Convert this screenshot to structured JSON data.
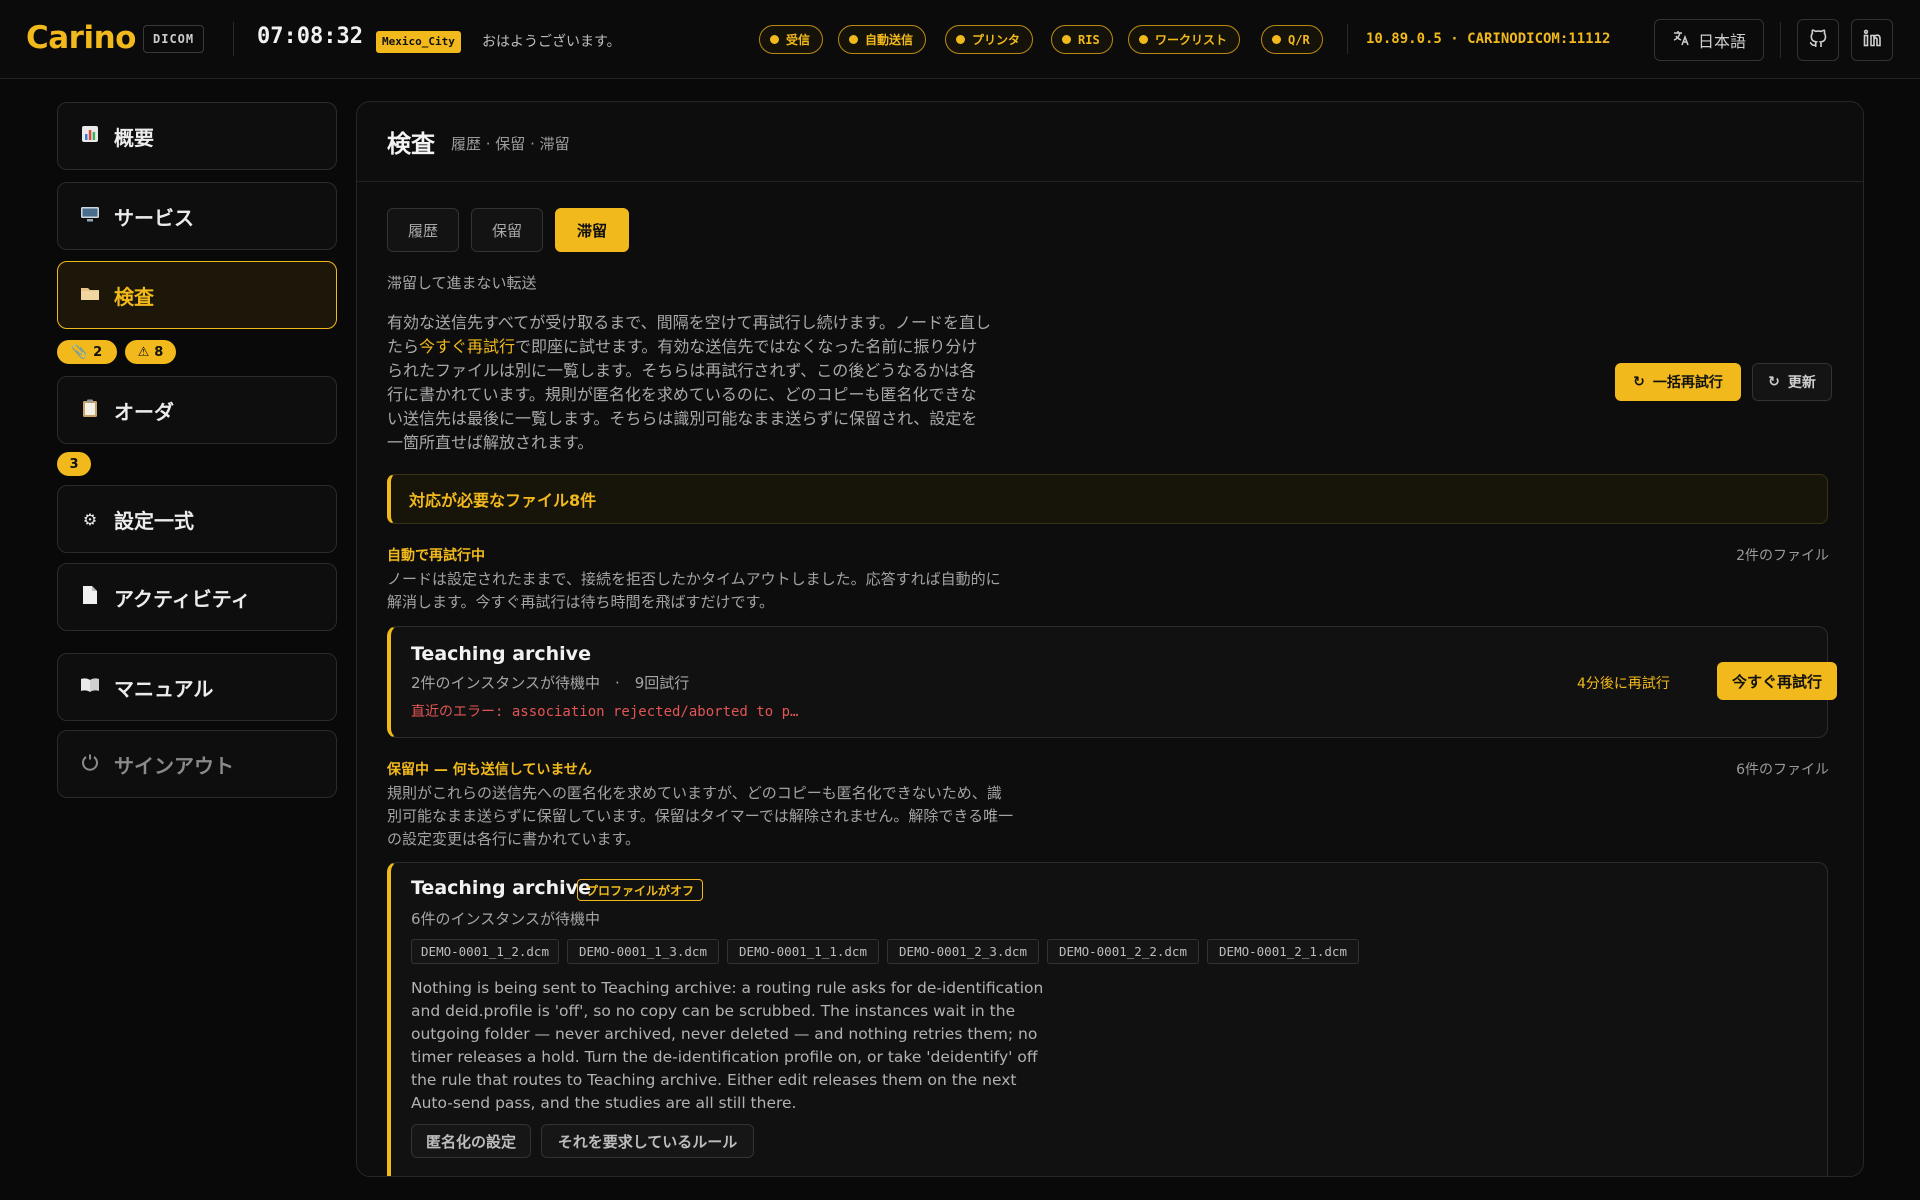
{
  "header": {
    "logo": "Carino",
    "badge": "DICOM",
    "clock": "07:08:32",
    "timezone": "Mexico_City",
    "greeting": "おはようございます。",
    "services": [
      "受信",
      "自動送信",
      "プリンタ",
      "RIS",
      "ワークリスト",
      "Q/R"
    ],
    "host": "10.89.0.5 · CARINODICOM:11112",
    "language": "日本語",
    "icons": [
      "translate-icon",
      "github-icon",
      "linkedin-icon"
    ]
  },
  "sidebar": {
    "items": [
      {
        "label": "概要",
        "icon": "chart-icon"
      },
      {
        "label": "サービス",
        "icon": "monitor-icon"
      },
      {
        "label": "検査",
        "icon": "folder-icon"
      },
      {
        "label": "オーダ",
        "icon": "clipboard-icon"
      },
      {
        "label": "設定一式",
        "icon": "gear-icon"
      },
      {
        "label": "アクティビティ",
        "icon": "document-icon"
      },
      {
        "label": "マニュアル",
        "icon": "book-icon"
      },
      {
        "label": "サインアウト",
        "icon": "power-icon"
      }
    ],
    "exam_badges": {
      "clip": "2",
      "warn": "8"
    },
    "order_badge": "3"
  },
  "main": {
    "title": "検査",
    "subtitle": "履歴 · 保留 · 滞留",
    "tabs": [
      "履歴",
      "保留",
      "滞留"
    ],
    "active_tab": "滞留",
    "caption": "滞留して進まない転送",
    "intro_a": "有効な送信先すべてが受け取るまで、間隔を空けて再試行し続けます。ノードを直したら",
    "intro_link": "今すぐ再試行",
    "intro_b": "で即座に試せます。有効な送信先ではなくなった名前に振り分けられたファイルは別に一覧します。そちらは再試行されず、この後どうなるかは各行に書かれています。規則が匿名化を求めているのに、どのコピーも匿名化できない送信先は最後に一覧します。そちらは識別可能なまま送らずに保留され、設定を一箇所直せば解放されます。",
    "bulk_retry": "一括再試行",
    "refresh": "更新",
    "alert": "対応が必要なファイル8件",
    "groups": [
      {
        "title": "自動で再試行中",
        "count": "2件のファイル",
        "desc": "ノードは設定されたままで、接続を拒否したかタイムアウトしました。応答すれば自動的に解消します。今すぐ再試行は待ち時間を飛ばすだけです。",
        "card": {
          "name": "Teaching archive",
          "sub": "2件のインスタンスが待機中　·　9回試行",
          "error": "直近のエラー: association rejected/aborted to p…",
          "retry_in": "4分後に再試行",
          "retry_now": "今すぐ再試行"
        }
      },
      {
        "title": "保留中 — 何も送信していません",
        "count": "6件のファイル",
        "desc": "規則がこれらの送信先への匿名化を求めていますが、どのコピーも匿名化できないため、識別可能なまま送らずに保留しています。保留はタイマーでは解除されません。解除できる唯一の設定変更は各行に書かれています。",
        "card": {
          "name": "Teaching archive",
          "tag": "プロファイルがオフ",
          "sub": "6件のインスタンスが待機中",
          "files": [
            "DEMO-0001_1_2.dcm",
            "DEMO-0001_1_3.dcm",
            "DEMO-0001_1_1.dcm",
            "DEMO-0001_2_3.dcm",
            "DEMO-0001_2_2.dcm",
            "DEMO-0001_2_1.dcm"
          ],
          "text": "Nothing is being sent to Teaching archive: a routing rule asks for de-identification and deid.profile is 'off', so no copy can be scrubbed. The instances wait in the outgoing folder — never archived, never deleted — and nothing retries them; no timer releases a hold. Turn the de-identification profile on, or take 'deidentify' off the rule that routes to Teaching archive. Either edit releases them on the next Auto-send pass, and the studies are all still there.",
          "btn_deid": "匿名化の設定",
          "btn_rule": "それを要求しているルール"
        }
      }
    ]
  },
  "colors": {
    "accent": "#f1b91c",
    "error": "#e25555",
    "background": "#090909"
  }
}
